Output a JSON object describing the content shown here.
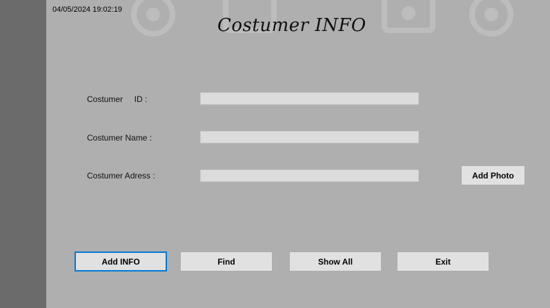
{
  "form": {
    "datetime": "04/05/2024 19:02:19",
    "title": "Costumer INFO",
    "fields": {
      "id_label": "Costumer     ID :",
      "id_value": "",
      "name_label": "Costumer Name :",
      "name_value": "",
      "adress_label": "Costumer Adress :",
      "adress_value": ""
    },
    "buttons": {
      "add_photo": "Add Photo",
      "add_info": "Add INFO",
      "find": "Find",
      "show_all": "Show All",
      "exit": "Exit"
    }
  },
  "colors": {
    "form_background": "#afafaf",
    "left_panel": "#6b6b6b",
    "field_background": "#dcdcdc",
    "button_background": "#e1e1e1",
    "focus_border": "#0078d7"
  },
  "icons": [
    "watermark-icon"
  ]
}
